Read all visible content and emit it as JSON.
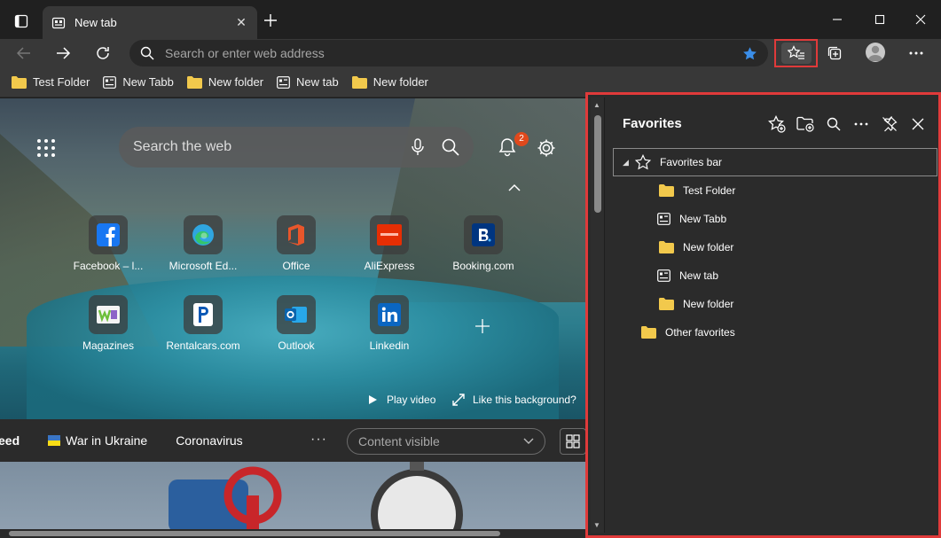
{
  "colors": {
    "accent_red": "#e03a3a",
    "star_blue": "#3b8ee8",
    "folder_yellow": "#f2c94c",
    "badge_orange": "#e0491c"
  },
  "tab": {
    "title": "New tab"
  },
  "toolbar": {
    "address_placeholder": "Search or enter web address"
  },
  "bookmarks": [
    {
      "label": "Test Folder",
      "icon": "folder-icon"
    },
    {
      "label": "New Tabb",
      "icon": "page-icon"
    },
    {
      "label": "New folder",
      "icon": "folder-icon"
    },
    {
      "label": "New tab",
      "icon": "page-icon"
    },
    {
      "label": "New folder",
      "icon": "folder-icon"
    }
  ],
  "newtab": {
    "search_placeholder": "Search the web",
    "notification_count": "2",
    "tiles": [
      {
        "label": "Facebook – l...",
        "icon": "facebook-icon"
      },
      {
        "label": "Microsoft Ed...",
        "icon": "edge-icon"
      },
      {
        "label": "Office",
        "icon": "office-icon"
      },
      {
        "label": "AliExpress",
        "icon": "aliexpress-icon"
      },
      {
        "label": "Booking.com",
        "icon": "booking-icon"
      },
      {
        "label": "Magazines",
        "icon": "magazines-icon"
      },
      {
        "label": "Rentalcars.com",
        "icon": "rentalcars-icon"
      },
      {
        "label": "Outlook",
        "icon": "outlook-icon"
      },
      {
        "label": "Linkedin",
        "icon": "linkedin-icon"
      }
    ],
    "play_video": "Play video",
    "like_background": "Like this background?",
    "feed": {
      "tab_partial": "eed",
      "items": [
        "War in Ukraine",
        "Coronavirus"
      ],
      "content_select": "Content visible"
    }
  },
  "favorites": {
    "title": "Favorites",
    "tree": [
      {
        "label": "Favorites bar",
        "icon": "star-outline-icon",
        "level": 0,
        "expanded": true,
        "selected": true
      },
      {
        "label": "Test Folder",
        "icon": "folder-icon",
        "level": 1
      },
      {
        "label": "New Tabb",
        "icon": "page-icon",
        "level": 1
      },
      {
        "label": "New folder",
        "icon": "folder-icon",
        "level": 1
      },
      {
        "label": "New tab",
        "icon": "page-icon",
        "level": 1
      },
      {
        "label": "New folder",
        "icon": "folder-icon",
        "level": 1
      },
      {
        "label": "Other favorites",
        "icon": "folder-icon",
        "level": 0
      }
    ]
  }
}
